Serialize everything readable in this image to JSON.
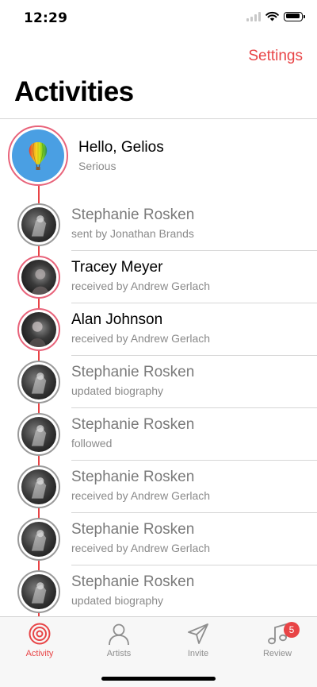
{
  "status_bar": {
    "time": "12:29"
  },
  "header": {
    "settings_label": "Settings",
    "title": "Activities"
  },
  "colors": {
    "accent": "#e84446",
    "timeline": "#e84446",
    "muted_text": "#8a8a8a"
  },
  "top_item": {
    "name": "Hello, Gelios",
    "subtitle": "Serious",
    "avatar_icon": "hot-air-balloon-icon"
  },
  "activities": [
    {
      "name": "Stephanie Rosken",
      "subtitle": "sent by Jonathan Brands"
    },
    {
      "name": "Tracey Meyer",
      "subtitle": "received by Andrew Gerlach"
    },
    {
      "name": "Alan Johnson",
      "subtitle": "received by Andrew Gerlach"
    },
    {
      "name": "Stephanie Rosken",
      "subtitle": "updated biography"
    },
    {
      "name": "Stephanie Rosken",
      "subtitle": "followed"
    },
    {
      "name": "Stephanie Rosken",
      "subtitle": "received by Andrew Gerlach"
    },
    {
      "name": "Stephanie Rosken",
      "subtitle": "received by Andrew Gerlach"
    },
    {
      "name": "Stephanie Rosken",
      "subtitle": "updated biography"
    }
  ],
  "tabs": [
    {
      "label": "Activity",
      "icon": "activity-icon",
      "active": true
    },
    {
      "label": "Artists",
      "icon": "person-icon"
    },
    {
      "label": "Invite",
      "icon": "paper-plane-icon"
    },
    {
      "label": "Review",
      "icon": "music-note-icon",
      "badge": "5"
    }
  ]
}
